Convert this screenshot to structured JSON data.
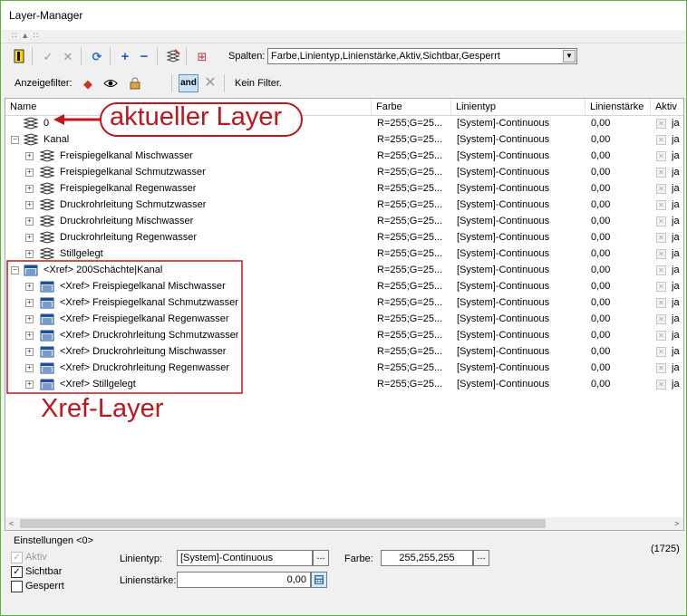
{
  "window": {
    "title": "Layer-Manager"
  },
  "toolbar": {
    "spalten_label": "Spalten:",
    "spalten_value": "Farbe,Linientyp,Linienstärke,Aktiv,Sichtbar,Gesperrt"
  },
  "filterbar": {
    "label": "Anzeigefilter:",
    "and_label": "and",
    "filter_text": "Kein Filter."
  },
  "columns": [
    "Name",
    "Farbe",
    "Linientyp",
    "Linienstärke",
    "Aktiv"
  ],
  "rows": [
    {
      "name": "0",
      "farbe": "R=255;G=25...",
      "linientyp": "[System]-Continuous",
      "staerke": "0,00",
      "aktiv": "ja",
      "level": 1,
      "toggle": "",
      "xref": false
    },
    {
      "name": "Kanal",
      "farbe": "R=255;G=25...",
      "linientyp": "[System]-Continuous",
      "staerke": "0,00",
      "aktiv": "ja",
      "level": 0,
      "toggle": "−",
      "xref": false
    },
    {
      "name": "Freispiegelkanal Mischwasser",
      "farbe": "R=255;G=25...",
      "linientyp": "[System]-Continuous",
      "staerke": "0,00",
      "aktiv": "ja",
      "level": 2,
      "toggle": "+",
      "xref": false
    },
    {
      "name": "Freispiegelkanal Schmutzwasser",
      "farbe": "R=255;G=25...",
      "linientyp": "[System]-Continuous",
      "staerke": "0,00",
      "aktiv": "ja",
      "level": 2,
      "toggle": "+",
      "xref": false
    },
    {
      "name": "Freispiegelkanal Regenwasser",
      "farbe": "R=255;G=25...",
      "linientyp": "[System]-Continuous",
      "staerke": "0,00",
      "aktiv": "ja",
      "level": 2,
      "toggle": "+",
      "xref": false
    },
    {
      "name": "Druckrohrleitung Schmutzwasser",
      "farbe": "R=255;G=25...",
      "linientyp": "[System]-Continuous",
      "staerke": "0,00",
      "aktiv": "ja",
      "level": 2,
      "toggle": "+",
      "xref": false
    },
    {
      "name": "Druckrohrleitung Mischwasser",
      "farbe": "R=255;G=25...",
      "linientyp": "[System]-Continuous",
      "staerke": "0,00",
      "aktiv": "ja",
      "level": 2,
      "toggle": "+",
      "xref": false
    },
    {
      "name": "Druckrohrleitung Regenwasser",
      "farbe": "R=255;G=25...",
      "linientyp": "[System]-Continuous",
      "staerke": "0,00",
      "aktiv": "ja",
      "level": 2,
      "toggle": "+",
      "xref": false
    },
    {
      "name": "Stillgelegt",
      "farbe": "R=255;G=25...",
      "linientyp": "[System]-Continuous",
      "staerke": "0,00",
      "aktiv": "ja",
      "level": 2,
      "toggle": "+",
      "xref": false
    },
    {
      "name": "<Xref> 200Schächte|Kanal",
      "farbe": "R=255;G=25...",
      "linientyp": "[System]-Continuous",
      "staerke": "0,00",
      "aktiv": "ja",
      "level": 0,
      "toggle": "−",
      "xref": true
    },
    {
      "name": "<Xref> Freispiegelkanal Mischwasser",
      "farbe": "R=255;G=25...",
      "linientyp": "[System]-Continuous",
      "staerke": "0,00",
      "aktiv": "ja",
      "level": 2,
      "toggle": "+",
      "xref": true
    },
    {
      "name": "<Xref> Freispiegelkanal Schmutzwasser",
      "farbe": "R=255;G=25...",
      "linientyp": "[System]-Continuous",
      "staerke": "0,00",
      "aktiv": "ja",
      "level": 2,
      "toggle": "+",
      "xref": true
    },
    {
      "name": "<Xref> Freispiegelkanal Regenwasser",
      "farbe": "R=255;G=25...",
      "linientyp": "[System]-Continuous",
      "staerke": "0,00",
      "aktiv": "ja",
      "level": 2,
      "toggle": "+",
      "xref": true
    },
    {
      "name": "<Xref> Druckrohrleitung Schmutzwasser",
      "farbe": "R=255;G=25...",
      "linientyp": "[System]-Continuous",
      "staerke": "0,00",
      "aktiv": "ja",
      "level": 2,
      "toggle": "+",
      "xref": true
    },
    {
      "name": "<Xref> Druckrohrleitung Mischwasser",
      "farbe": "R=255;G=25...",
      "linientyp": "[System]-Continuous",
      "staerke": "0,00",
      "aktiv": "ja",
      "level": 2,
      "toggle": "+",
      "xref": true
    },
    {
      "name": "<Xref> Druckrohrleitung Regenwasser",
      "farbe": "R=255;G=25...",
      "linientyp": "[System]-Continuous",
      "staerke": "0,00",
      "aktiv": "ja",
      "level": 2,
      "toggle": "+",
      "xref": true
    },
    {
      "name": "<Xref> Stillgelegt",
      "farbe": "R=255;G=25...",
      "linientyp": "[System]-Continuous",
      "staerke": "0,00",
      "aktiv": "ja",
      "level": 2,
      "toggle": "+",
      "xref": true
    }
  ],
  "annotations": {
    "current_layer": "aktueller Layer",
    "xref_layer": "Xref-Layer",
    "color": "#c0161b"
  },
  "settings": {
    "title": "Einstellungen <0>",
    "count": "(1725)",
    "aktiv_label": "Aktiv",
    "sichtbar_label": "Sichtbar",
    "gesperrt_label": "Gesperrt",
    "linientyp_label": "Linientyp:",
    "linientyp_value": "[System]-Continuous",
    "farbe_label": "Farbe:",
    "farbe_value": "255,255,255",
    "staerke_label": "Linienstärke:",
    "staerke_value": "0,00",
    "dots_label": "...",
    "check_mark": "✓"
  }
}
